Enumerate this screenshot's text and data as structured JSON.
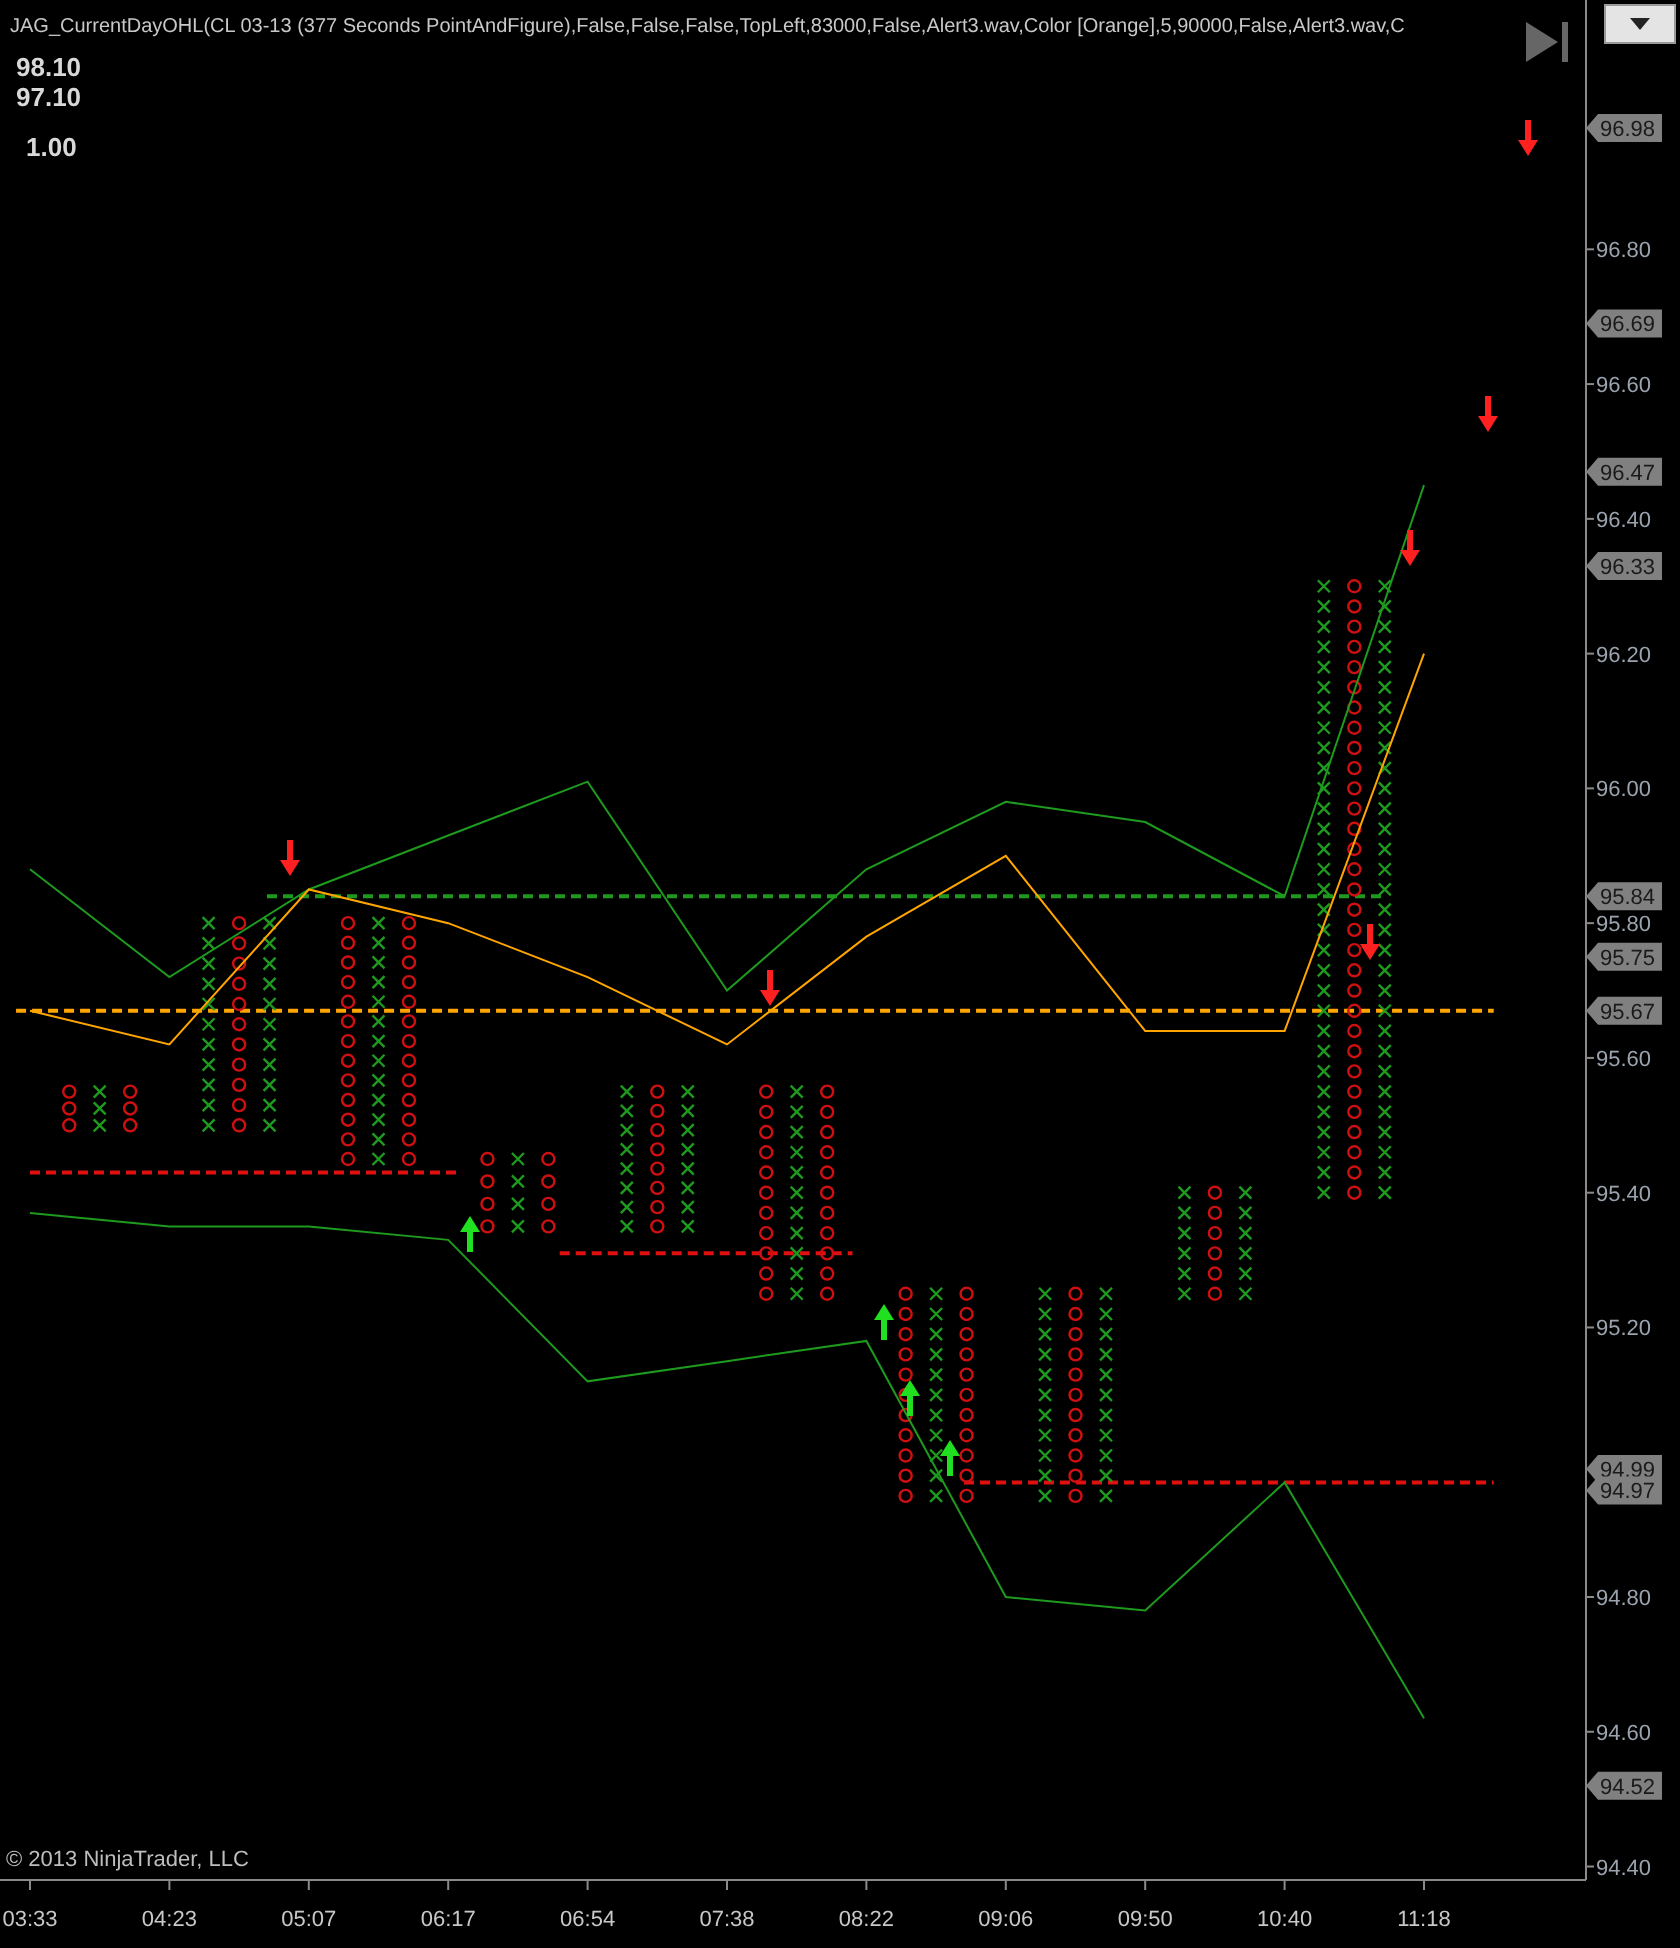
{
  "title": "JAG_CurrentDayOHL(CL 03-13 (377 Seconds PointAndFigure),False,False,False,TopLeft,83000,False,Alert3.wav,Color [Orange],5,90000,False,Alert3.wav,C",
  "readings": [
    "98.10",
    "97.10",
    "1.00"
  ],
  "copyright": "© 2013 NinjaTrader, LLC",
  "price_markers": [
    "96.98",
    "96.69",
    "96.47",
    "96.33",
    "95.84",
    "95.75",
    "95.67",
    "94.99",
    "94.97",
    "94.52"
  ],
  "chart_data": {
    "type": "line",
    "categories": [
      "03:33",
      "04:23",
      "05:07",
      "06:17",
      "06:54",
      "07:38",
      "08:22",
      "09:06",
      "09:50",
      "10:40",
      "11:18"
    ],
    "ylim": [
      94.38,
      97.17
    ],
    "yticks": [
      {
        "value": 94.4,
        "label": "94.40"
      },
      {
        "value": 94.6,
        "label": "94.60"
      },
      {
        "value": 94.8,
        "label": "94.80"
      },
      {
        "value": 95.2,
        "label": "95.20"
      },
      {
        "value": 95.4,
        "label": "95.40"
      },
      {
        "value": 95.6,
        "label": "95.60"
      },
      {
        "value": 95.8,
        "label": "95.80"
      },
      {
        "value": 96.0,
        "label": "96.00"
      },
      {
        "value": 96.2,
        "label": "96.20"
      },
      {
        "value": 96.4,
        "label": "96.40"
      },
      {
        "value": 96.6,
        "label": "96.60"
      },
      {
        "value": 96.8,
        "label": "96.80"
      }
    ],
    "series": [
      {
        "color": "#1e9a1e",
        "values": [
          95.88,
          95.72,
          95.85,
          95.93,
          96.01,
          95.7,
          95.88,
          95.98,
          95.95,
          95.84,
          96.45
        ]
      },
      {
        "color": "#ffa500",
        "values": [
          95.67,
          95.62,
          95.85,
          95.8,
          95.72,
          95.62,
          95.78,
          95.9,
          95.64,
          95.64,
          96.2
        ]
      },
      {
        "color": "#1e9a1e",
        "values": [
          95.37,
          95.35,
          95.35,
          95.33,
          95.12,
          95.15,
          95.18,
          94.8,
          94.78,
          94.97,
          94.62
        ]
      }
    ]
  }
}
